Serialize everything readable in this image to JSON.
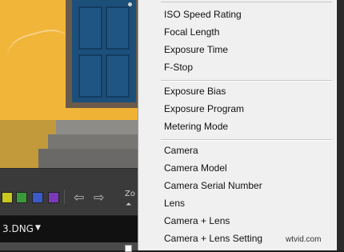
{
  "toolbar": {
    "color_labels": [
      {
        "name": "yellow",
        "color": "#c8c81e"
      },
      {
        "name": "green",
        "color": "#3a9a3a"
      },
      {
        "name": "blue",
        "color": "#3a5ac8"
      },
      {
        "name": "purple",
        "color": "#7a3ab8"
      }
    ],
    "zoom_label": "Zo",
    "zoom_icon": "zoom-slider-icon"
  },
  "filmstrip": {
    "filename": "3.DNG"
  },
  "menu": {
    "group1": [
      "ISO Speed Rating",
      "Focal Length",
      "Exposure Time",
      "F-Stop"
    ],
    "group2": [
      "Exposure Bias",
      "Exposure Program",
      "Metering Mode"
    ],
    "group3": [
      "Camera",
      "Camera Model",
      "Camera Serial Number",
      "Lens",
      "Camera + Lens",
      "Camera + Lens Setting"
    ]
  },
  "watermark": "wtvid.com"
}
